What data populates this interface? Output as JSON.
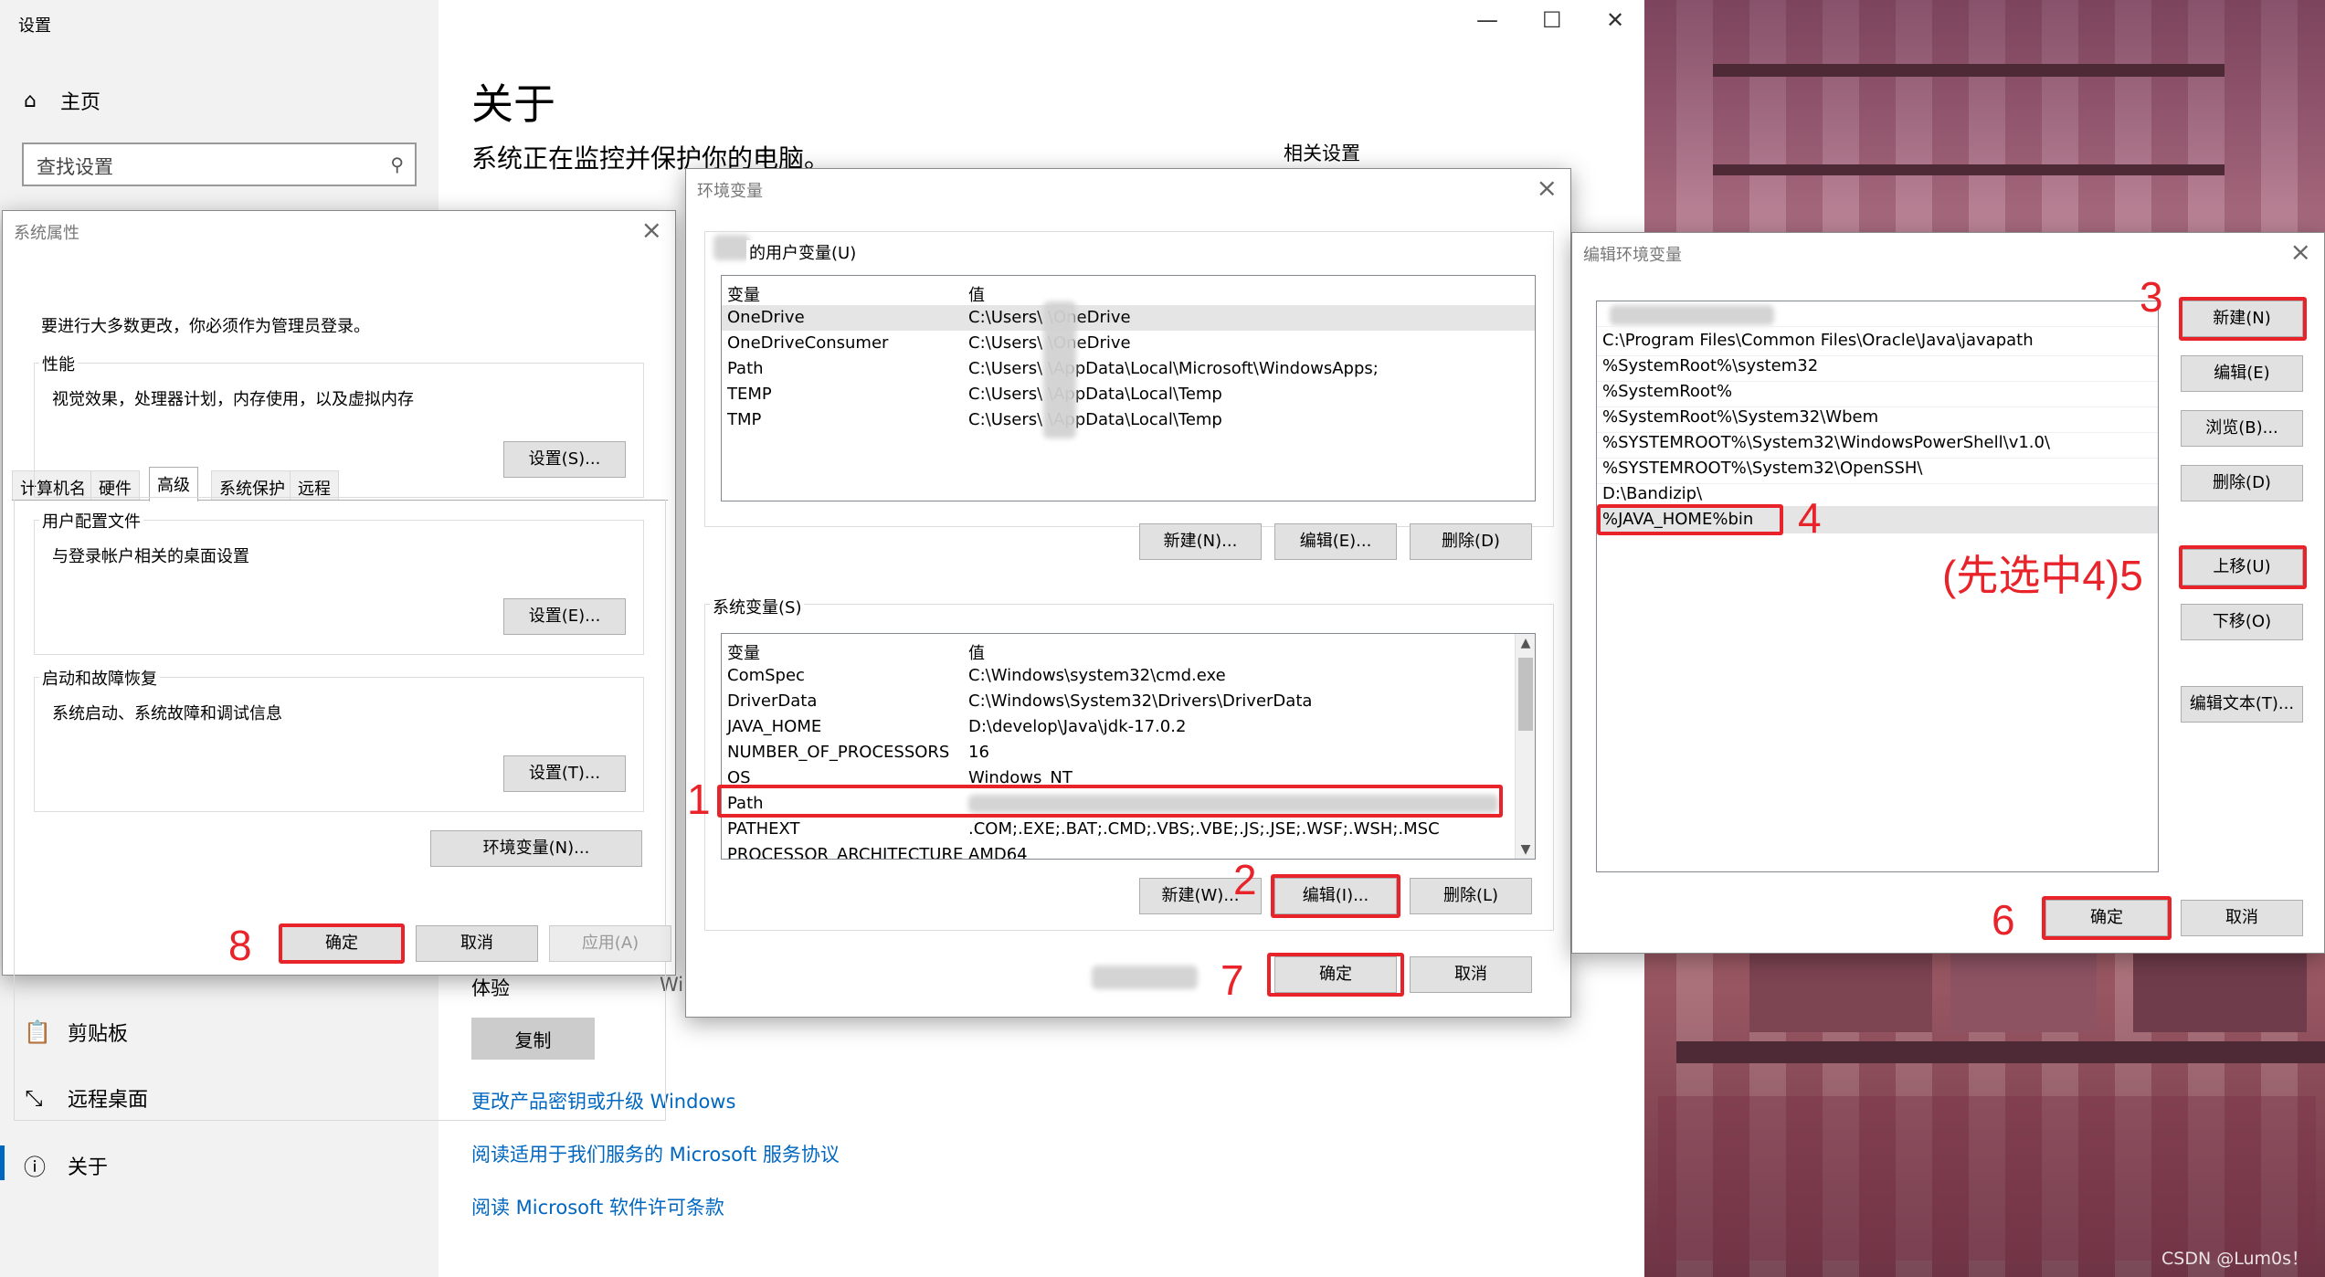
{
  "settings": {
    "app_title": "设置",
    "home": "主页",
    "search_placeholder": "查找设置",
    "page_title": "关于",
    "page_subtitle": "系统正在监控并保护你的电脑。",
    "related": "相关设置",
    "experience_label": "体验",
    "experience_value": "Wi",
    "copy_button": "复制",
    "sidebar_items": [
      "剪贴板",
      "远程桌面",
      "关于"
    ],
    "links": [
      "更改产品密钥或升级 Windows",
      "阅读适用于我们服务的 Microsoft 服务协议",
      "阅读 Microsoft 软件许可条款"
    ]
  },
  "sysprops": {
    "title": "系统属性",
    "tabs": [
      "计算机名",
      "硬件",
      "高级",
      "系统保护",
      "远程"
    ],
    "admin_note": "要进行大多数更改，你必须作为管理员登录。",
    "perf_label": "性能",
    "perf_desc": "视觉效果，处理器计划，内存使用，以及虚拟内存",
    "perf_btn": "设置(S)...",
    "profile_label": "用户配置文件",
    "profile_desc": "与登录帐户相关的桌面设置",
    "profile_btn": "设置(E)...",
    "startup_label": "启动和故障恢复",
    "startup_desc": "系统启动、系统故障和调试信息",
    "startup_btn": "设置(T)...",
    "env_btn": "环境变量(N)...",
    "ok": "确定",
    "cancel": "取消",
    "apply": "应用(A)"
  },
  "envvars": {
    "title": "环境变量",
    "user_label": "的用户变量(U)",
    "col_var": "变量",
    "col_val": "值",
    "user_vars": [
      {
        "name": "OneDrive",
        "value": "C:\\Users\\      \\OneDrive"
      },
      {
        "name": "OneDriveConsumer",
        "value": "C:\\Users\\      \\OneDrive"
      },
      {
        "name": "Path",
        "value": "C:\\Users\\      \\AppData\\Local\\Microsoft\\WindowsApps;"
      },
      {
        "name": "TEMP",
        "value": "C:\\Users\\      \\AppData\\Local\\Temp"
      },
      {
        "name": "TMP",
        "value": "C:\\Users\\      \\AppData\\Local\\Temp"
      }
    ],
    "user_new": "新建(N)...",
    "user_edit": "编辑(E)...",
    "user_delete": "删除(D)",
    "sys_label": "系统变量(S)",
    "sys_vars": [
      {
        "name": "ComSpec",
        "value": "C:\\Windows\\system32\\cmd.exe"
      },
      {
        "name": "DriverData",
        "value": "C:\\Windows\\System32\\Drivers\\DriverData"
      },
      {
        "name": "JAVA_HOME",
        "value": "D:\\develop\\Java\\jdk-17.0.2"
      },
      {
        "name": "NUMBER_OF_PROCESSORS",
        "value": "16"
      },
      {
        "name": "OS",
        "value": "Windows_NT"
      },
      {
        "name": "Path",
        "value": ""
      },
      {
        "name": "PATHEXT",
        "value": ".COM;.EXE;.BAT;.CMD;.VBS;.VBE;.JS;.JSE;.WSF;.WSH;.MSC"
      },
      {
        "name": "PROCESSOR_ARCHITECTURE",
        "value": "AMD64"
      }
    ],
    "sys_new": "新建(W)...",
    "sys_edit": "编辑(I)...",
    "sys_delete": "删除(L)",
    "ok": "确定",
    "cancel": "取消"
  },
  "editenv": {
    "title": "编辑环境变量",
    "items": [
      "C:\\Program Files\\Common Files\\Oracle\\Java\\javapath",
      "%SystemRoot%\\system32",
      "%SystemRoot%",
      "%SystemRoot%\\System32\\Wbem",
      "%SYSTEMROOT%\\System32\\WindowsPowerShell\\v1.0\\",
      "%SYSTEMROOT%\\System32\\OpenSSH\\",
      "D:\\Bandizip\\",
      "%JAVA_HOME%bin"
    ],
    "btn_new": "新建(N)",
    "btn_edit": "编辑(E)",
    "btn_browse": "浏览(B)...",
    "btn_delete": "删除(D)",
    "btn_up": "上移(U)",
    "btn_down": "下移(O)",
    "btn_edit_text": "编辑文本(T)...",
    "ok": "确定",
    "cancel": "取消"
  },
  "annotations": {
    "n1": "1",
    "n2": "2",
    "n3": "3",
    "n4": "4",
    "n5": "(先选中4)5",
    "n6": "6",
    "n7": "7",
    "n8": "8"
  },
  "watermark": "CSDN @Lum0s！",
  "colors": {
    "annotation_red": "#e8232a",
    "link_blue": "#0067c0"
  }
}
